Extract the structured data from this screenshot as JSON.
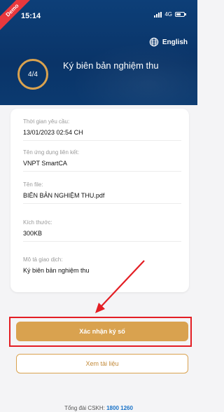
{
  "status_bar": {
    "time": "15:14",
    "network": "4G",
    "ribbon": "Demo"
  },
  "header": {
    "language": "English",
    "step": "4/4",
    "title": "Ký biên bản nghiệm thu"
  },
  "details": [
    {
      "label": "Thời gian yêu cầu:",
      "value": "13/01/2023 02:54 CH"
    },
    {
      "label": "Tên ứng dụng liên kết:",
      "value": "VNPT SmartCA"
    },
    {
      "label": "Tên file:",
      "value": "BIÊN BẢN NGHIỆM THU.pdf"
    },
    {
      "label": "Kích thước:",
      "value": "300KB"
    },
    {
      "label": "Mô tả giao dịch:",
      "value": "Ký biên bản nghiệm thu"
    }
  ],
  "actions": {
    "confirm_label": "Xác nhận ký số",
    "view_label": "Xem tài liệu"
  },
  "footer": {
    "hotline_label": "Tổng đài CSKH:",
    "hotline_number": "1800 1260"
  },
  "colors": {
    "header_bg": "#0b3a70",
    "accent": "#d9a24f",
    "highlight": "#e31e24"
  }
}
